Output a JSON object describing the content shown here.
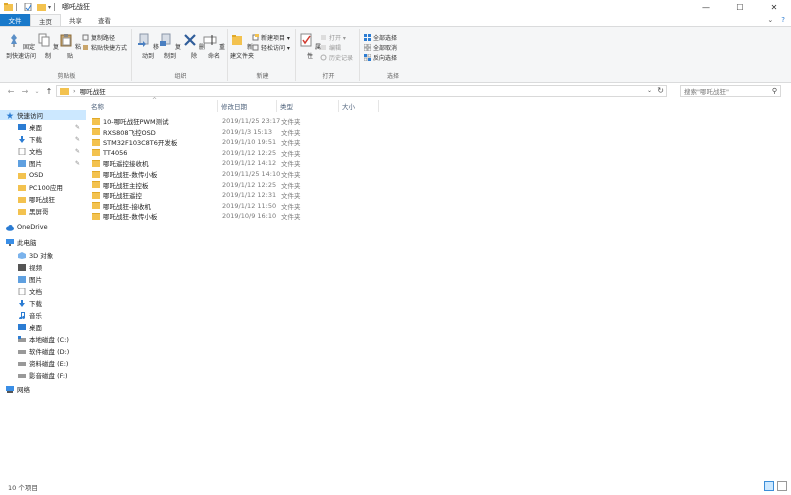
{
  "window": {
    "title": "哪吒战狂",
    "controls": [
      "—",
      "☐",
      "✕"
    ]
  },
  "ribbon_tabs": {
    "file": "文件",
    "home": "主页",
    "share": "共享",
    "view": "查看",
    "collapse": "⌄",
    "help": "?"
  },
  "ribbon": {
    "clipboard": {
      "label": "剪贴板",
      "pin": "固定到快速访问",
      "copy": "复制",
      "paste": "粘贴",
      "copy_path": "复制路径",
      "paste_shortcut": "粘贴快捷方式"
    },
    "organize": {
      "label": "组织",
      "move_to": "移动到",
      "copy_to": "复制到",
      "delete": "删除",
      "rename": "重命名"
    },
    "new": {
      "label": "新建",
      "new_folder": "新建文件夹",
      "new_item": "新建项目 ▾",
      "easy_access": "轻松访问 ▾"
    },
    "open": {
      "label": "打开",
      "properties": "属性",
      "open": "打开 ▾",
      "edit": "编辑",
      "history": "历史记录"
    },
    "select": {
      "label": "选择",
      "select_all": "全部选择",
      "select_none": "全部取消",
      "invert": "反向选择"
    }
  },
  "address": {
    "path": "哪吒战狂",
    "search_placeholder": "搜索\"哪吒战狂\""
  },
  "nav": {
    "quick_access": "快速访问",
    "items": [
      {
        "label": "桌面",
        "pinned": true
      },
      {
        "label": "下载",
        "pinned": true
      },
      {
        "label": "文档",
        "pinned": true
      },
      {
        "label": "图片",
        "pinned": true
      },
      {
        "label": "OSD",
        "pinned": false
      },
      {
        "label": "PC100应用",
        "pinned": false
      },
      {
        "label": "哪吒战狂",
        "pinned": false
      },
      {
        "label": "黑屏哥",
        "pinned": false
      }
    ],
    "onedrive": "OneDrive",
    "this_pc": "此电脑",
    "pc_items": [
      {
        "label": "3D 对象"
      },
      {
        "label": "视频"
      },
      {
        "label": "图片"
      },
      {
        "label": "文档"
      },
      {
        "label": "下载"
      },
      {
        "label": "音乐"
      },
      {
        "label": "桌面"
      },
      {
        "label": "本地磁盘 (C:)"
      },
      {
        "label": "软件磁盘 (D:)"
      },
      {
        "label": "资料磁盘 (E:)"
      },
      {
        "label": "影音磁盘 (F:)"
      }
    ],
    "network": "网络"
  },
  "columns": {
    "name": "名称",
    "date": "修改日期",
    "type": "类型",
    "size": "大小"
  },
  "files": [
    {
      "name": "10-哪吒战狂PWM测试",
      "date": "2019/11/25 23:17",
      "type": "文件夹"
    },
    {
      "name": "RXS808飞控OSD",
      "date": "2019/1/3 15:13",
      "type": "文件夹"
    },
    {
      "name": "STM32F103C8T6开发板",
      "date": "2019/1/10 19:51",
      "type": "文件夹"
    },
    {
      "name": "TT4056",
      "date": "2019/1/12 12:25",
      "type": "文件夹"
    },
    {
      "name": "哪吒遥控接收机",
      "date": "2019/1/12 14:12",
      "type": "文件夹"
    },
    {
      "name": "哪吒战狂-数传小板",
      "date": "2019/11/25 14:10",
      "type": "文件夹"
    },
    {
      "name": "哪吒战狂主控板",
      "date": "2019/1/12 12:25",
      "type": "文件夹"
    },
    {
      "name": "哪吒战狂遥控",
      "date": "2019/1/12 12:31",
      "type": "文件夹"
    },
    {
      "name": "哪吒战狂-接收机",
      "date": "2019/1/12 11:50",
      "type": "文件夹"
    },
    {
      "name": "哪吒战狂-数传小板",
      "date": "2019/10/9 16:10",
      "type": "文件夹"
    }
  ],
  "status": {
    "count": "10 个项目"
  }
}
